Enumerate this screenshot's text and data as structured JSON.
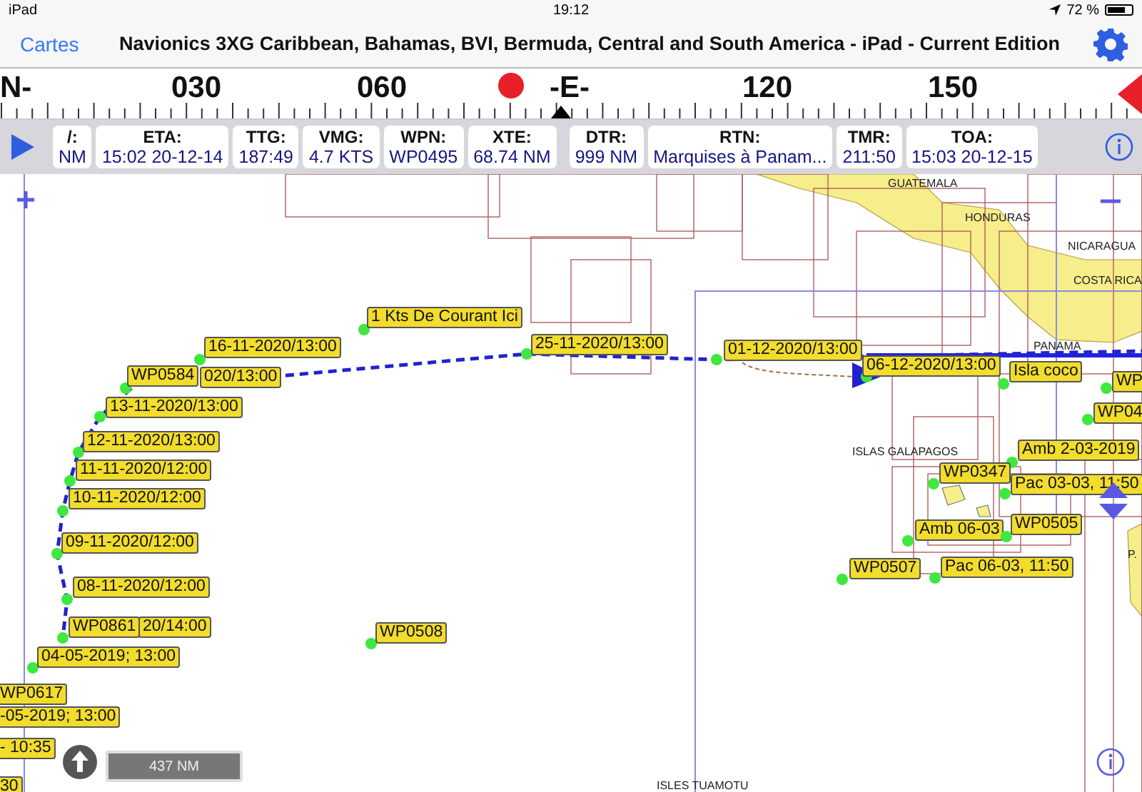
{
  "status_bar": {
    "device": "iPad",
    "time": "19:12",
    "battery": "72 %"
  },
  "nav_bar": {
    "back": "Cartes",
    "title": "Navionics 3XG Caribbean, Bahamas, BVI, Bermuda, Central and South America - iPad - Current Edition"
  },
  "compass": {
    "labels": [
      "N-",
      "030",
      "060",
      "-E-",
      "120",
      "150"
    ]
  },
  "instruments": [
    {
      "label": "/:",
      "value": "NM"
    },
    {
      "label": "ETA:",
      "value": "15:02 20-12-14"
    },
    {
      "label": "TTG:",
      "value": "187:49"
    },
    {
      "label": "VMG:",
      "value": "4.7 KTS"
    },
    {
      "label": "WPN:",
      "value": "WP0495"
    },
    {
      "label": "XTE:",
      "value": "68.74 NM"
    },
    {
      "label": "DTR:",
      "value": "999 NM"
    },
    {
      "label": "RTN:",
      "value": "Marquises à Panam..."
    },
    {
      "label": "TMR:",
      "value": "211:50"
    },
    {
      "label": "TOA:",
      "value": "15:03 20-12-15"
    }
  ],
  "map": {
    "place_names": [
      "GUATEMALA",
      "HONDURAS",
      "NICARAGUA",
      "COSTA RICA",
      "PANAMA",
      "ISLAS GALAPAGOS",
      "P.",
      "ISLES TUAMOTU"
    ],
    "scale": "437 NM",
    "waypoints": [
      {
        "text": "1 Kts De Courant Ici"
      },
      {
        "text": "16-11-2020/13:00"
      },
      {
        "text": "WP0584"
      },
      {
        "text": "020/13:00"
      },
      {
        "text": "13-11-2020/13:00"
      },
      {
        "text": "12-11-2020/13:00"
      },
      {
        "text": "11-11-2020/12:00"
      },
      {
        "text": "10-11-2020/12:00"
      },
      {
        "text": "09-11-2020/12:00"
      },
      {
        "text": "08-11-2020/12:00"
      },
      {
        "text": "WP0861"
      },
      {
        "text": "20/14:00"
      },
      {
        "text": "04-05-2019; 13:00"
      },
      {
        "text": "WP0617"
      },
      {
        "text": "-05-2019; 13:00"
      },
      {
        "text": "- 10:35"
      },
      {
        "text": "30"
      },
      {
        "text": "WP0508"
      },
      {
        "text": "25-11-2020/13:00"
      },
      {
        "text": "01-12-2020/13:00"
      },
      {
        "text": "06-12-2020/13:00"
      },
      {
        "text": "Isla coco"
      },
      {
        "text": "WP"
      },
      {
        "text": "WP04"
      },
      {
        "text": "Amb 2-03-2019"
      },
      {
        "text": "WP0347"
      },
      {
        "text": "Pac 03-03, 11:50"
      },
      {
        "text": "Amb 06-03"
      },
      {
        "text": "WP0505"
      },
      {
        "text": "WP0507"
      },
      {
        "text": "Pac 06-03, 11:50"
      }
    ]
  }
}
